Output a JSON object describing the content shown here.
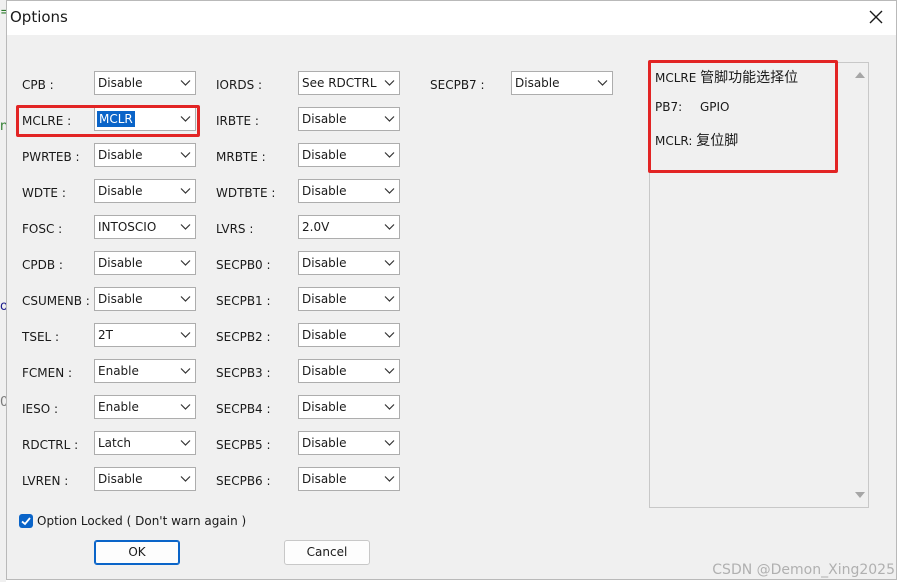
{
  "window": {
    "title": "Options",
    "close_symbol": "✕"
  },
  "left_column": [
    {
      "label": "CPB :",
      "value": "Disable"
    },
    {
      "label": "MCLRE :",
      "value": "MCLR",
      "focused": true
    },
    {
      "label": "PWRTEB :",
      "value": "Disable"
    },
    {
      "label": "WDTE :",
      "value": "Disable"
    },
    {
      "label": "FOSC :",
      "value": "INTOSCIO"
    },
    {
      "label": "CPDB :",
      "value": "Disable"
    },
    {
      "label": "CSUMENB :",
      "value": "Disable"
    },
    {
      "label": "TSEL :",
      "value": "2T"
    },
    {
      "label": "FCMEN :",
      "value": "Enable"
    },
    {
      "label": "IESO :",
      "value": "Enable"
    },
    {
      "label": "RDCTRL :",
      "value": "Latch"
    },
    {
      "label": "LVREN :",
      "value": "Disable"
    }
  ],
  "middle_column": [
    {
      "label": "IORDS :",
      "value": "See RDCTRL"
    },
    {
      "label": "IRBTE :",
      "value": "Disable"
    },
    {
      "label": "MRBTE :",
      "value": "Disable"
    },
    {
      "label": "WDTBTE :",
      "value": "Disable"
    },
    {
      "label": "LVRS :",
      "value": "2.0V"
    },
    {
      "label": "SECPB0 :",
      "value": "Disable"
    },
    {
      "label": "SECPB1 :",
      "value": "Disable"
    },
    {
      "label": "SECPB2 :",
      "value": "Disable"
    },
    {
      "label": "SECPB3 :",
      "value": "Disable"
    },
    {
      "label": "SECPB4 :",
      "value": "Disable"
    },
    {
      "label": "SECPB5 :",
      "value": "Disable"
    },
    {
      "label": "SECPB6 :",
      "value": "Disable"
    }
  ],
  "right_column": [
    {
      "label": "SECPB7 :",
      "value": "Disable"
    }
  ],
  "description": {
    "line1_key": "MCLRE",
    "line1_text": "管脚功能选择位",
    "line2_key": "PB7:",
    "line2_text": "GPIO",
    "line3_key": "MCLR:",
    "line3_text": "复位脚"
  },
  "option_locked": {
    "label": "Option Locked ( Don't warn again )",
    "checked": true
  },
  "buttons": {
    "ok": "OK",
    "cancel": "Cancel"
  },
  "watermark": "CSDN @Demon_Xing2025",
  "colors": {
    "highlight": "#e22424",
    "accent": "#0a64c8"
  }
}
